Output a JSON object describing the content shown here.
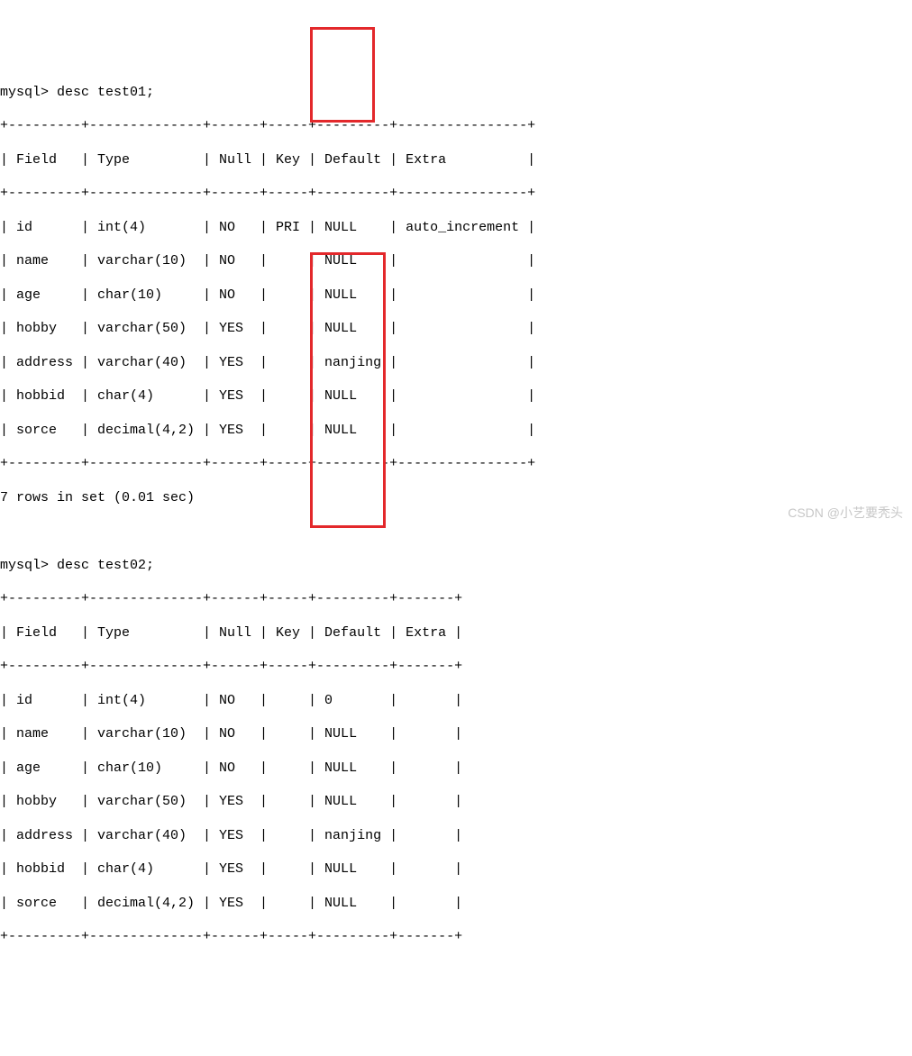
{
  "prompt1": "mysql> desc test01;",
  "sep_top1": "+---------+--------------+------+-----+---------+----------------+",
  "header1": "| Field   | Type         | Null | Key | Default | Extra          |",
  "sep_mid1": "+---------+--------------+------+-----+---------+----------------+",
  "t1r1": "| id      | int(4)       | NO   | PRI | NULL    | auto_increment |",
  "t1r2": "| name    | varchar(10)  | NO   |     | NULL    |                |",
  "t1r3": "| age     | char(10)     | NO   |     | NULL    |                |",
  "t1r4": "| hobby   | varchar(50)  | YES  |     | NULL    |                |",
  "t1r5": "| address | varchar(40)  | YES  |     | nanjing |                |",
  "t1r6": "| hobbid  | char(4)      | YES  |     | NULL    |                |",
  "t1r7": "| sorce   | decimal(4,2) | YES  |     | NULL    |                |",
  "sep_bot1": "+---------+--------------+------+-----+---------+----------------+",
  "rows_msg": "7 rows in set (0.01 sec)",
  "blank": " ",
  "prompt2": "mysql> desc test02;",
  "sep_top2": "+---------+--------------+------+-----+---------+-------+",
  "header2": "| Field   | Type         | Null | Key | Default | Extra |",
  "sep_mid2": "+---------+--------------+------+-----+---------+-------+",
  "t2r1": "| id      | int(4)       | NO   |     | 0       |       |",
  "t2r2": "| name    | varchar(10)  | NO   |     | NULL    |       |",
  "t2r3": "| age     | char(10)     | NO   |     | NULL    |       |",
  "t2r4": "| hobby   | varchar(50)  | YES  |     | NULL    |       |",
  "t2r5": "| address | varchar(40)  | YES  |     | nanjing |       |",
  "t2r6": "| hobbid  | char(4)      | YES  |     | NULL    |       |",
  "t2r7": "| sorce   | decimal(4,2) | YES  |     | NULL    |       |",
  "sep_bot2": "+---------+--------------+------+-----+---------+-------+",
  "watermark": "CSDN @小艺要秃头",
  "chart_data": [
    {
      "type": "table",
      "title": "desc test01",
      "columns": [
        "Field",
        "Type",
        "Null",
        "Key",
        "Default",
        "Extra"
      ],
      "rows": [
        [
          "id",
          "int(4)",
          "NO",
          "PRI",
          "NULL",
          "auto_increment"
        ],
        [
          "name",
          "varchar(10)",
          "NO",
          "",
          "NULL",
          ""
        ],
        [
          "age",
          "char(10)",
          "NO",
          "",
          "NULL",
          ""
        ],
        [
          "hobby",
          "varchar(50)",
          "YES",
          "",
          "NULL",
          ""
        ],
        [
          "address",
          "varchar(40)",
          "YES",
          "",
          "nanjing",
          ""
        ],
        [
          "hobbid",
          "char(4)",
          "YES",
          "",
          "NULL",
          ""
        ],
        [
          "sorce",
          "decimal(4,2)",
          "YES",
          "",
          "NULL",
          ""
        ]
      ]
    },
    {
      "type": "table",
      "title": "desc test02",
      "columns": [
        "Field",
        "Type",
        "Null",
        "Key",
        "Default",
        "Extra"
      ],
      "rows": [
        [
          "id",
          "int(4)",
          "NO",
          "",
          "0",
          ""
        ],
        [
          "name",
          "varchar(10)",
          "NO",
          "",
          "NULL",
          ""
        ],
        [
          "age",
          "char(10)",
          "NO",
          "",
          "NULL",
          ""
        ],
        [
          "hobby",
          "varchar(50)",
          "YES",
          "",
          "NULL",
          ""
        ],
        [
          "address",
          "varchar(40)",
          "YES",
          "",
          "nanjing",
          ""
        ],
        [
          "hobbid",
          "char(4)",
          "YES",
          "",
          "NULL",
          ""
        ],
        [
          "sorce",
          "decimal(4,2)",
          "YES",
          "",
          "NULL",
          ""
        ]
      ]
    }
  ]
}
